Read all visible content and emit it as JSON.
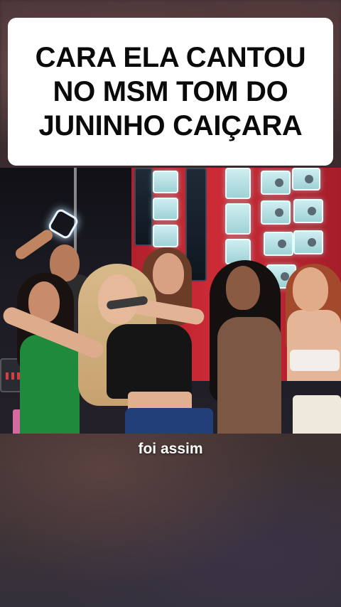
{
  "overlay": {
    "caption_line1": "CARA ELA CANTOU",
    "caption_line2": "NO MSM TOM DO",
    "caption_line3": "JUNINHO CAIÇARA"
  },
  "subtitle": {
    "text": "foi assim"
  },
  "colors": {
    "caption_bg": "#ffffff",
    "caption_text": "#0a0a0a",
    "subtitle_text": "#ffffff",
    "stage_red": "#cc2b35",
    "speaker_glow": "#cfeef0"
  }
}
